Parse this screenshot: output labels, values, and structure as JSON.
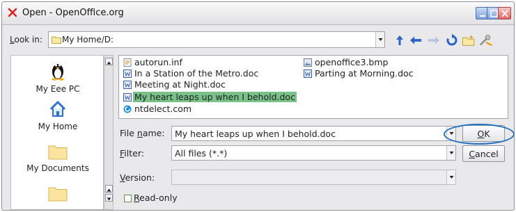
{
  "window": {
    "title": "Open - OpenOffice.org"
  },
  "lookin": {
    "label_prefix": "L",
    "label_rest": "ook in:",
    "path": "My Home/D:"
  },
  "toolbar": {
    "icons": [
      "up-arrow-icon",
      "back-arrow-icon",
      "forward-arrow-icon",
      "refresh-icon",
      "new-folder-icon",
      "options-icon"
    ]
  },
  "places": [
    {
      "label": "My Eee PC",
      "icon": "tux-icon"
    },
    {
      "label": "My Home",
      "icon": "home-icon"
    },
    {
      "label": "My Documents",
      "icon": "folder-icon"
    },
    {
      "label": "",
      "icon": "folder-icon"
    }
  ],
  "files": {
    "column1": [
      {
        "name": "autorun.inf",
        "icon": "text-file-icon",
        "selected": false
      },
      {
        "name": "In a Station of the Metro.doc",
        "icon": "doc-file-icon",
        "selected": false
      },
      {
        "name": "Meeting at Night.doc",
        "icon": "doc-file-icon",
        "selected": false
      },
      {
        "name": "My heart leaps up when I behold.doc",
        "icon": "doc-file-icon",
        "selected": true
      },
      {
        "name": "ntdelect.com",
        "icon": "com-file-icon",
        "selected": false
      }
    ],
    "column2": [
      {
        "name": "openoffice3.bmp",
        "icon": "image-file-icon",
        "selected": false
      },
      {
        "name": "Parting at Morning.doc",
        "icon": "doc-file-icon",
        "selected": false
      }
    ]
  },
  "form": {
    "filename_label_a": "File ",
    "filename_label_u": "n",
    "filename_label_b": "ame:",
    "filename_value": "My heart leaps up when I behold.doc",
    "filter_label_u": "F",
    "filter_label_rest": "ilter:",
    "filter_value": "All files (*.*)",
    "version_label_u": "V",
    "version_label_rest": "ersion:",
    "version_value": "",
    "readonly_label_u": "R",
    "readonly_label_rest": "ead-only",
    "readonly_checked": false
  },
  "buttons": {
    "ok_u": "O",
    "ok_rest": "K",
    "cancel_u": "C",
    "cancel_rest": "ancel"
  },
  "colors": {
    "selection": "#78c28a",
    "highlight_ring": "#1e6fc0",
    "toolbar_blue": "#2a64c8"
  }
}
